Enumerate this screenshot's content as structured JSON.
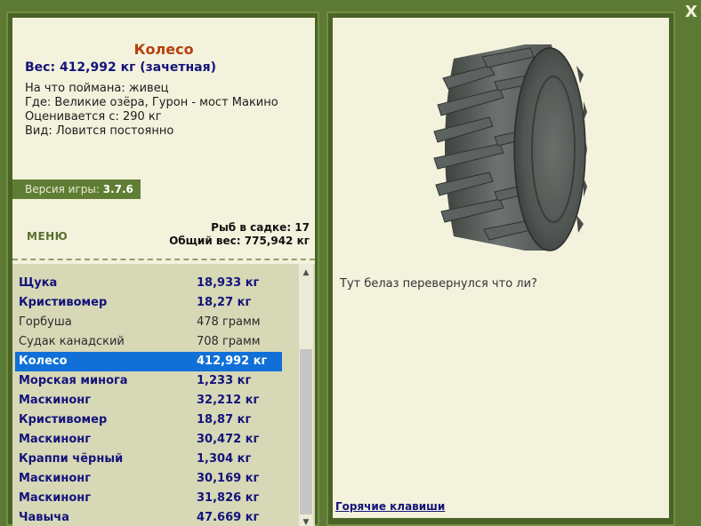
{
  "window": {
    "close_label": "X"
  },
  "fish_info": {
    "title": "Колесо",
    "weight_line": "Вес: 412,992 кг (зачетная)",
    "caught_on": "На что поймана: живец",
    "location": "Где: Великие озёра, Гурон - мост Макино",
    "valued_from": "Оценивается с: 290 кг",
    "species_type": "Вид: Ловится постоянно"
  },
  "version": {
    "label": "Версия игры: ",
    "number": "3.7.6"
  },
  "menu": {
    "label": "МЕНЮ"
  },
  "cage": {
    "count_line": "Рыб в садке: 17",
    "total_line": "Общий вес: 775,942 кг"
  },
  "fish_list": [
    {
      "name": "Щука",
      "weight": "18,933 кг",
      "trophy": true,
      "selected": false
    },
    {
      "name": "Кристивомер",
      "weight": "18,27 кг",
      "trophy": true,
      "selected": false
    },
    {
      "name": "Горбуша",
      "weight": "478 грамм",
      "trophy": false,
      "selected": false
    },
    {
      "name": "Судак канадский",
      "weight": "708 грамм",
      "trophy": false,
      "selected": false
    },
    {
      "name": "Колесо",
      "weight": "412,992 кг",
      "trophy": true,
      "selected": true
    },
    {
      "name": "Морская минога",
      "weight": "1,233 кг",
      "trophy": true,
      "selected": false
    },
    {
      "name": "Маскинонг",
      "weight": "32,212 кг",
      "trophy": true,
      "selected": false
    },
    {
      "name": "Кристивомер",
      "weight": "18,87 кг",
      "trophy": true,
      "selected": false
    },
    {
      "name": "Маскинонг",
      "weight": "30,472 кг",
      "trophy": true,
      "selected": false
    },
    {
      "name": "Краппи чёрный",
      "weight": "1,304 кг",
      "trophy": true,
      "selected": false
    },
    {
      "name": "Маскинонг",
      "weight": "30,169 кг",
      "trophy": true,
      "selected": false
    },
    {
      "name": "Маскинонг",
      "weight": "31,826 кг",
      "trophy": true,
      "selected": false
    },
    {
      "name": "Чавыча",
      "weight": "47.669 кг",
      "trophy": true,
      "selected": false
    }
  ],
  "scrollbar": {
    "up_icon": "arrow-up-icon",
    "down_icon": "arrow-down-icon"
  },
  "detail": {
    "image": "tire-image",
    "comment": "Тут белаз перевернулся что ли?",
    "hotkeys_label": "Горячие клавиши"
  }
}
